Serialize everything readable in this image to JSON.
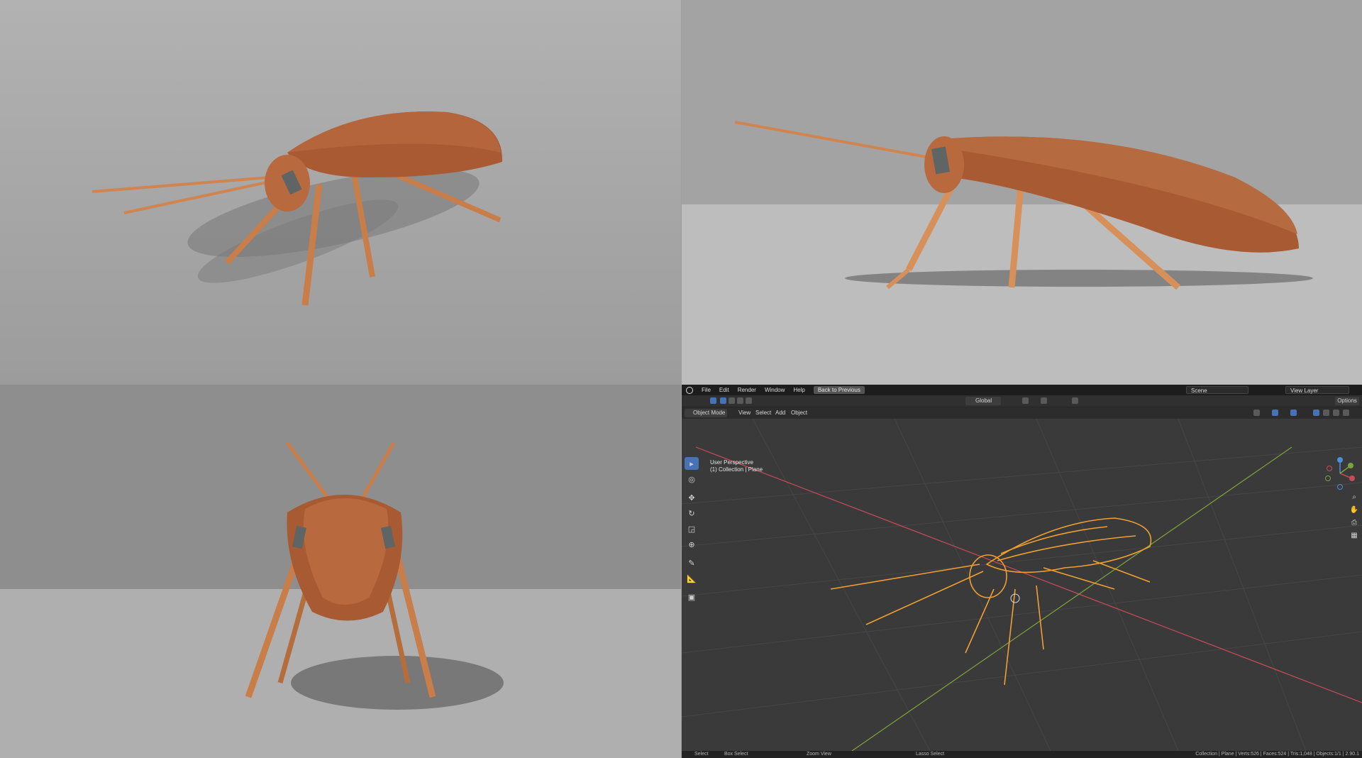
{
  "blender": {
    "menu": [
      "File",
      "Edit",
      "Render",
      "Window",
      "Help"
    ],
    "back_button": "Back to Previous",
    "scene": "Scene",
    "view_layer": "View Layer",
    "orientation": "Global",
    "options": "Options",
    "mode": "Object Mode",
    "header_menu": [
      "View",
      "Select",
      "Add",
      "Object"
    ],
    "viewport_title": "User Perspective",
    "viewport_subtitle": "(1) Collection | Plane",
    "status_left": {
      "select": "Select",
      "box_select": "Box Select",
      "zoom_view": "Zoom View",
      "lasso_select": "Lasso Select"
    },
    "status_right": "Collection | Plane | Verts:526 | Faces:524 | Tris:1,048 | Objects:1/1 | 2.90.1",
    "colors": {
      "accent": "#4772b3",
      "selection": "#f0a030",
      "x_axis": "#c94b5a",
      "y_axis": "#7ea33b",
      "bug_body": "#a85a33",
      "bug_legs": "#d88a50"
    },
    "icons": [
      "blender-logo-icon",
      "cursor-icon",
      "move-icon",
      "rotate-icon",
      "scale-icon",
      "transform-icon",
      "annotate-icon",
      "measure-icon",
      "add-cube-icon",
      "zoom-icon",
      "hand-icon",
      "camera-icon",
      "grid-icon"
    ]
  }
}
